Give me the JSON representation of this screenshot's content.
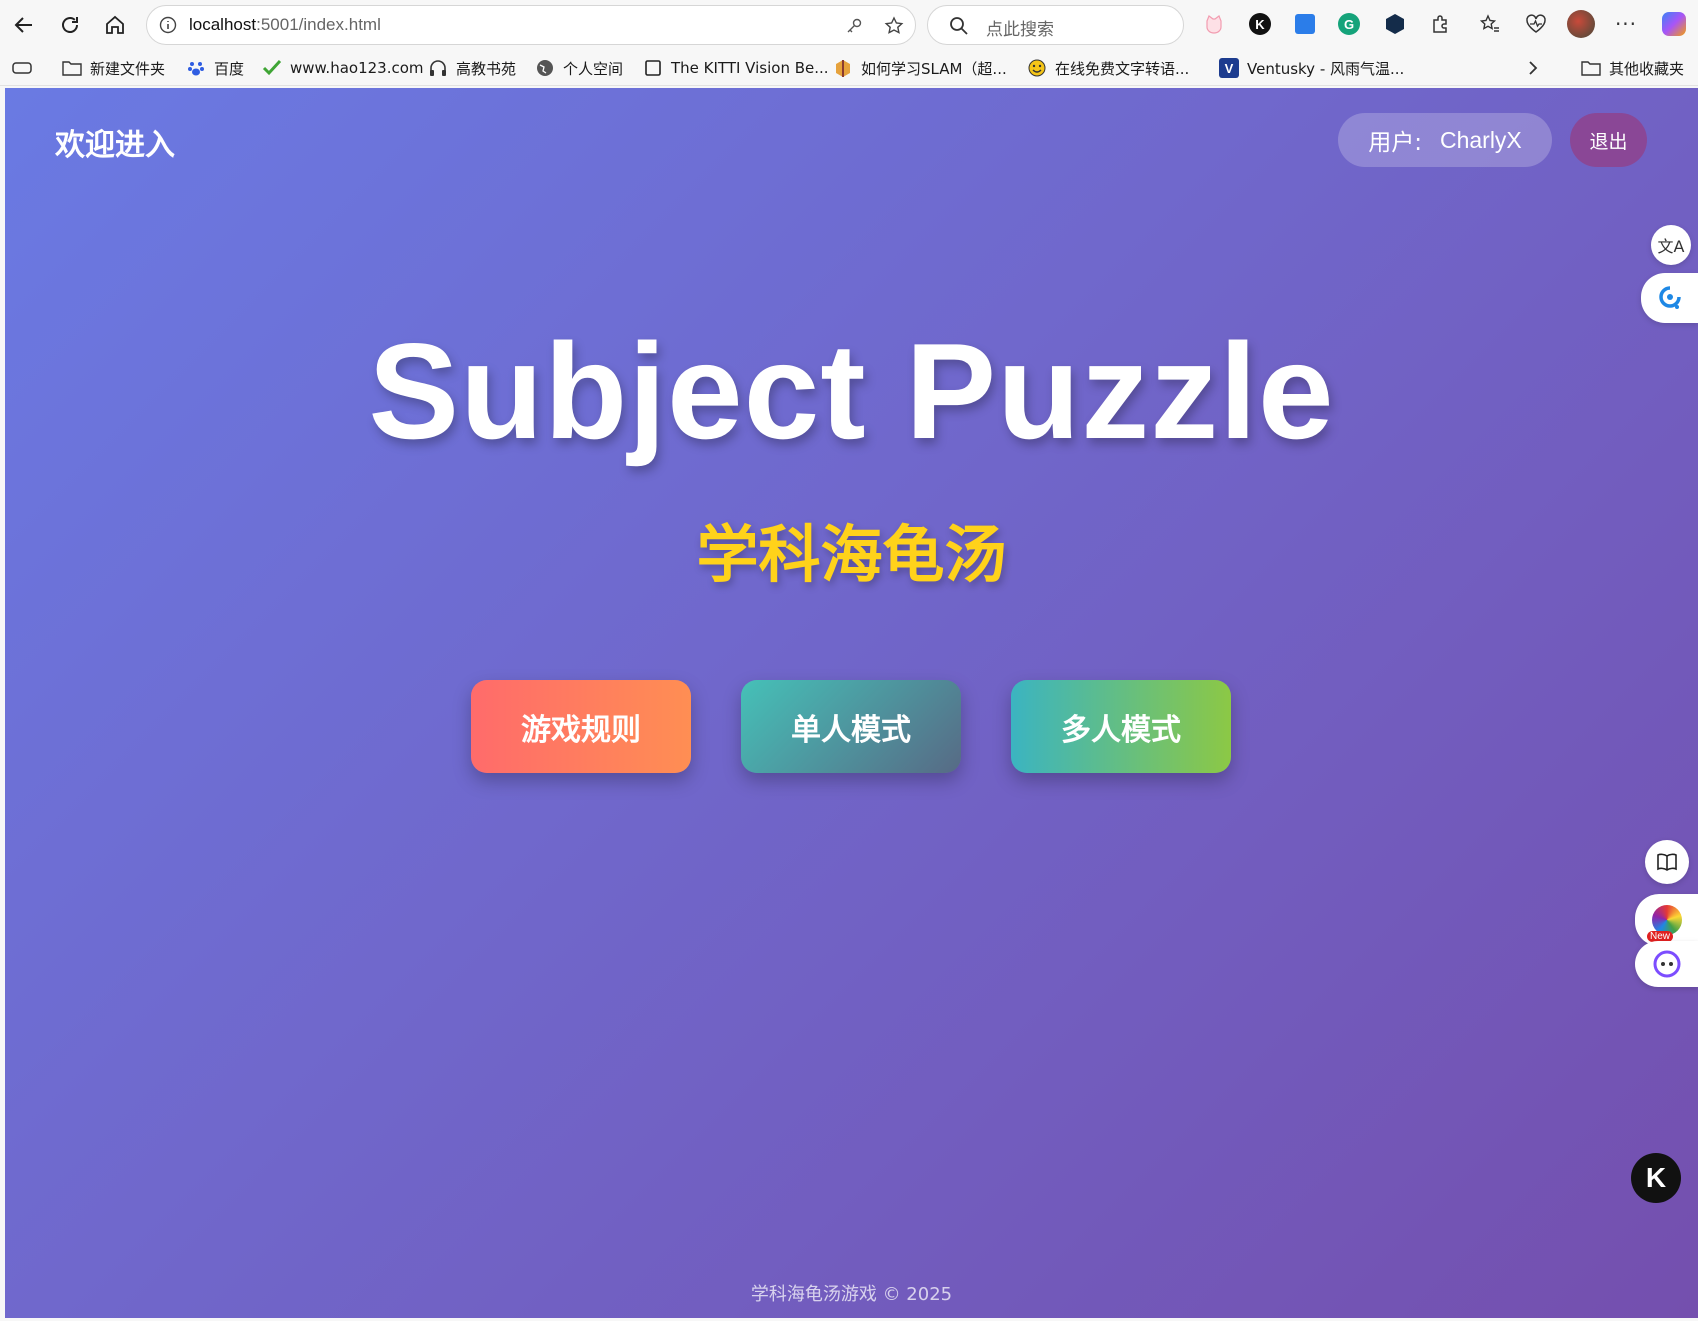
{
  "browser": {
    "url_host": "localhost",
    "url_rest": ":5001/index.html",
    "search_placeholder": "点此搜索",
    "bookmarks": [
      {
        "label": "新建文件夹",
        "icon": "folder-icon"
      },
      {
        "label": "百度",
        "icon": "baidu-icon"
      },
      {
        "label": "www.hao123.com",
        "icon": "hao123-icon"
      },
      {
        "label": "高教书苑",
        "icon": "headphones-icon"
      },
      {
        "label": "个人空间",
        "icon": "globe-icon"
      },
      {
        "label": "The KITTI Vision Be...",
        "icon": "page-icon"
      },
      {
        "label": "如何学习SLAM（超...",
        "icon": "zhihu-icon"
      },
      {
        "label": "在线免费文字转语...",
        "icon": "smile-icon"
      },
      {
        "label": "Ventusky - 风雨气温...",
        "icon": "ventusky-icon"
      }
    ],
    "other_bookmarks": "其他收藏夹"
  },
  "page": {
    "welcome": "欢迎进入",
    "user_label": "用户:",
    "username": "CharlyX",
    "logout": "退出",
    "title": "Subject Puzzle",
    "subtitle": "学科海龟汤",
    "buttons": {
      "rules": "游戏规则",
      "single": "单人模式",
      "multi": "多人模式"
    },
    "footer": "学科海龟汤游戏 © 2025"
  },
  "colors": {
    "gradient_start": "#6a7ae3",
    "gradient_end": "#744fae",
    "subtitle": "#ffd21a",
    "logout_bg": "#8a4796"
  }
}
